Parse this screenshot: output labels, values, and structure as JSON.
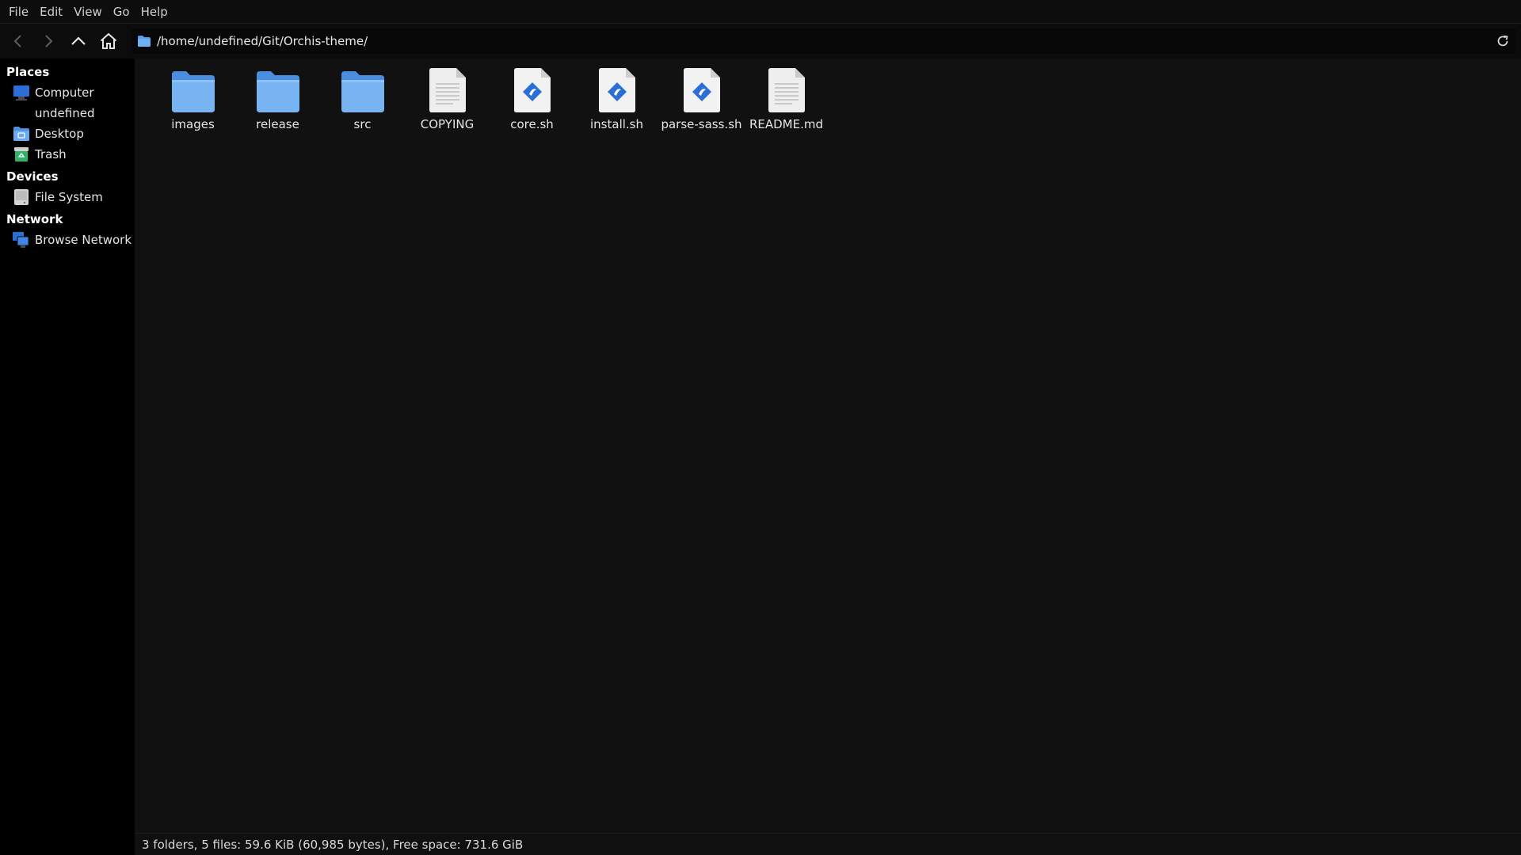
{
  "menu": {
    "items": [
      "File",
      "Edit",
      "View",
      "Go",
      "Help"
    ]
  },
  "toolbar": {
    "back_icon": "arrow-left-icon",
    "forward_icon": "arrow-right-icon",
    "up_icon": "chevron-up-icon",
    "home_icon": "home-icon",
    "path": "/home/undefined/Git/Orchis-theme/",
    "reload_icon": "reload-icon"
  },
  "sidebar": {
    "sections": [
      {
        "title": "Places",
        "items": [
          {
            "label": "Computer",
            "icon": "computer-icon"
          },
          {
            "label": "undefined",
            "icon": "home-folder-icon"
          },
          {
            "label": "Desktop",
            "icon": "desktop-icon"
          },
          {
            "label": "Trash",
            "icon": "trash-icon"
          }
        ]
      },
      {
        "title": "Devices",
        "items": [
          {
            "label": "File System",
            "icon": "drive-icon"
          }
        ]
      },
      {
        "title": "Network",
        "items": [
          {
            "label": "Browse Network",
            "icon": "network-icon"
          }
        ]
      }
    ]
  },
  "files": [
    {
      "name": "images",
      "type": "folder",
      "icon": "folder-icon"
    },
    {
      "name": "release",
      "type": "folder",
      "icon": "folder-icon"
    },
    {
      "name": "src",
      "type": "folder",
      "icon": "folder-icon"
    },
    {
      "name": "COPYING",
      "type": "text",
      "icon": "text-file-icon"
    },
    {
      "name": "core.sh",
      "type": "script",
      "icon": "script-file-icon"
    },
    {
      "name": "install.sh",
      "type": "script",
      "icon": "script-file-icon"
    },
    {
      "name": "parse-sass.sh",
      "type": "script",
      "icon": "script-file-icon"
    },
    {
      "name": "README.md",
      "type": "text",
      "icon": "text-file-icon"
    }
  ],
  "status": {
    "text": "3 folders, 5 files: 59.6 KiB (60,985 bytes), Free space: 731.6 GiB"
  },
  "colors": {
    "folder": "#5a9ee8",
    "accent": "#2b6fd6",
    "background": "#111111",
    "sidebar": "#000000"
  }
}
